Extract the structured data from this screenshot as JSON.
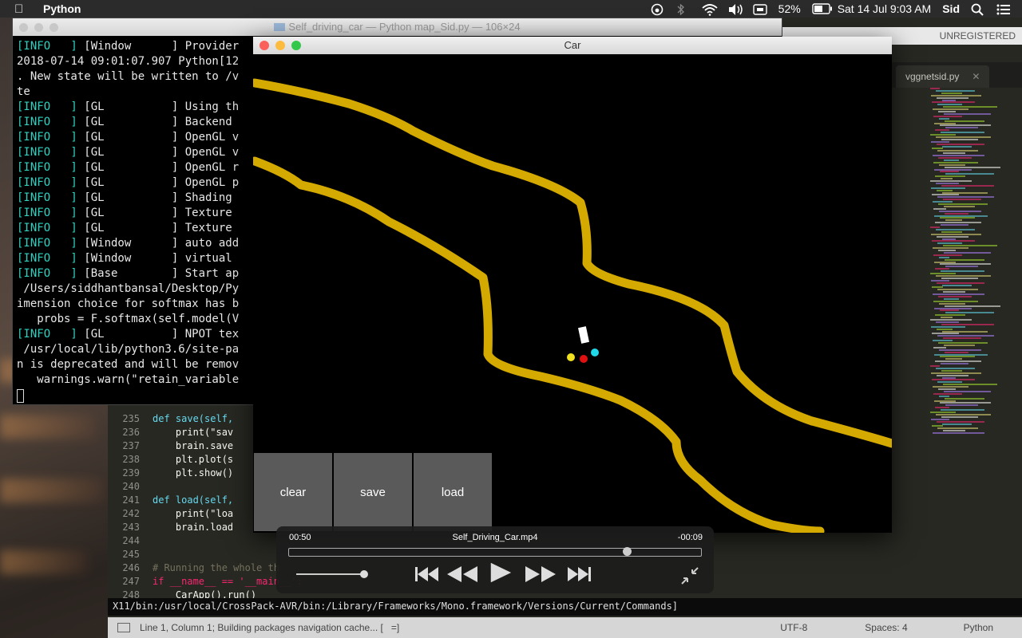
{
  "menubar": {
    "app_name": "Python",
    "battery": "52%",
    "datetime": "Sat 14 Jul  9:03 AM",
    "user": "Sid"
  },
  "editor": {
    "window_title": "Self_driving_car — Python map_Sid.py — 106×24",
    "unregistered": "UNREGISTERED",
    "tabs": [
      {
        "label": "vggnetsid.py"
      }
    ],
    "lines": [
      {
        "n": "235",
        "html": "def save(self,"
      },
      {
        "n": "236",
        "html": "    print(\"sav"
      },
      {
        "n": "237",
        "html": "    brain.save"
      },
      {
        "n": "238",
        "html": "    plt.plot(s"
      },
      {
        "n": "239",
        "html": "    plt.show()"
      },
      {
        "n": "240",
        "html": ""
      },
      {
        "n": "241",
        "html": "def load(self,"
      },
      {
        "n": "242",
        "html": "    print(\"loa"
      },
      {
        "n": "243",
        "html": "    brain.load"
      },
      {
        "n": "244",
        "html": ""
      },
      {
        "n": "245",
        "html": ""
      },
      {
        "n": "246",
        "html": "# Running the whole th"
      },
      {
        "n": "247",
        "html": "if __name__ == '__main__':"
      },
      {
        "n": "248",
        "html": "    CarApp().run()"
      },
      {
        "n": "249",
        "html": ""
      }
    ],
    "path_line": "X11/bin:/usr/local/CrossPack-AVR/bin:/Library/Frameworks/Mono.framework/Versions/Current/Commands]",
    "status": {
      "position": "Line 1, Column 1; Building packages navigation cache... [",
      "bracket": "=]",
      "encoding": "UTF-8",
      "spaces": "Spaces: 4",
      "syntax": "Python"
    }
  },
  "terminal": {
    "lines": [
      {
        "tag": "[INFO   ]",
        "text": " [Window      ] Provider"
      },
      {
        "tag": "",
        "text": "2018-07-14 09:01:07.907 Python[12"
      },
      {
        "tag": "",
        "text": ". New state will be written to /v"
      },
      {
        "tag": "",
        "text": "te"
      },
      {
        "tag": "[INFO   ]",
        "text": " [GL          ] Using th"
      },
      {
        "tag": "[INFO   ]",
        "text": " [GL          ] Backend"
      },
      {
        "tag": "[INFO   ]",
        "text": " [GL          ] OpenGL v"
      },
      {
        "tag": "[INFO   ]",
        "text": " [GL          ] OpenGL v"
      },
      {
        "tag": "[INFO   ]",
        "text": " [GL          ] OpenGL r"
      },
      {
        "tag": "[INFO   ]",
        "text": " [GL          ] OpenGL p"
      },
      {
        "tag": "[INFO   ]",
        "text": " [GL          ] Shading"
      },
      {
        "tag": "[INFO   ]",
        "text": " [GL          ] Texture"
      },
      {
        "tag": "[INFO   ]",
        "text": " [GL          ] Texture"
      },
      {
        "tag": "[INFO   ]",
        "text": " [Window      ] auto add"
      },
      {
        "tag": "[INFO   ]",
        "text": " [Window      ] virtual"
      },
      {
        "tag": "[INFO   ]",
        "text": " [Base        ] Start ap"
      },
      {
        "tag": "",
        "text": " /Users/siddhantbansal/Desktop/Py"
      },
      {
        "tag": "",
        "text": "imension choice for softmax has b"
      },
      {
        "tag": "",
        "text": "   probs = F.softmax(self.model(V"
      },
      {
        "tag": "[INFO   ]",
        "text": " [GL          ] NPOT tex"
      },
      {
        "tag": "",
        "text": " /usr/local/lib/python3.6/site-pa"
      },
      {
        "tag": "",
        "text": "n is deprecated and will be remov"
      },
      {
        "tag": "",
        "text": "   warnings.warn(\"retain_variable"
      }
    ]
  },
  "car_window": {
    "title": "Car",
    "buttons": {
      "clear": "clear",
      "save": "save",
      "load": "load"
    }
  },
  "video": {
    "elapsed": "00:50",
    "filename": "Self_Driving_Car.mp4",
    "remaining": "-00:09",
    "progress": 0.82,
    "volume": 1.0
  },
  "colors": {
    "road": "#d4a900",
    "sensor_left": "#f0e020",
    "sensor_center": "#e01010",
    "sensor_right": "#20d8e8",
    "car": "#ffffff"
  }
}
